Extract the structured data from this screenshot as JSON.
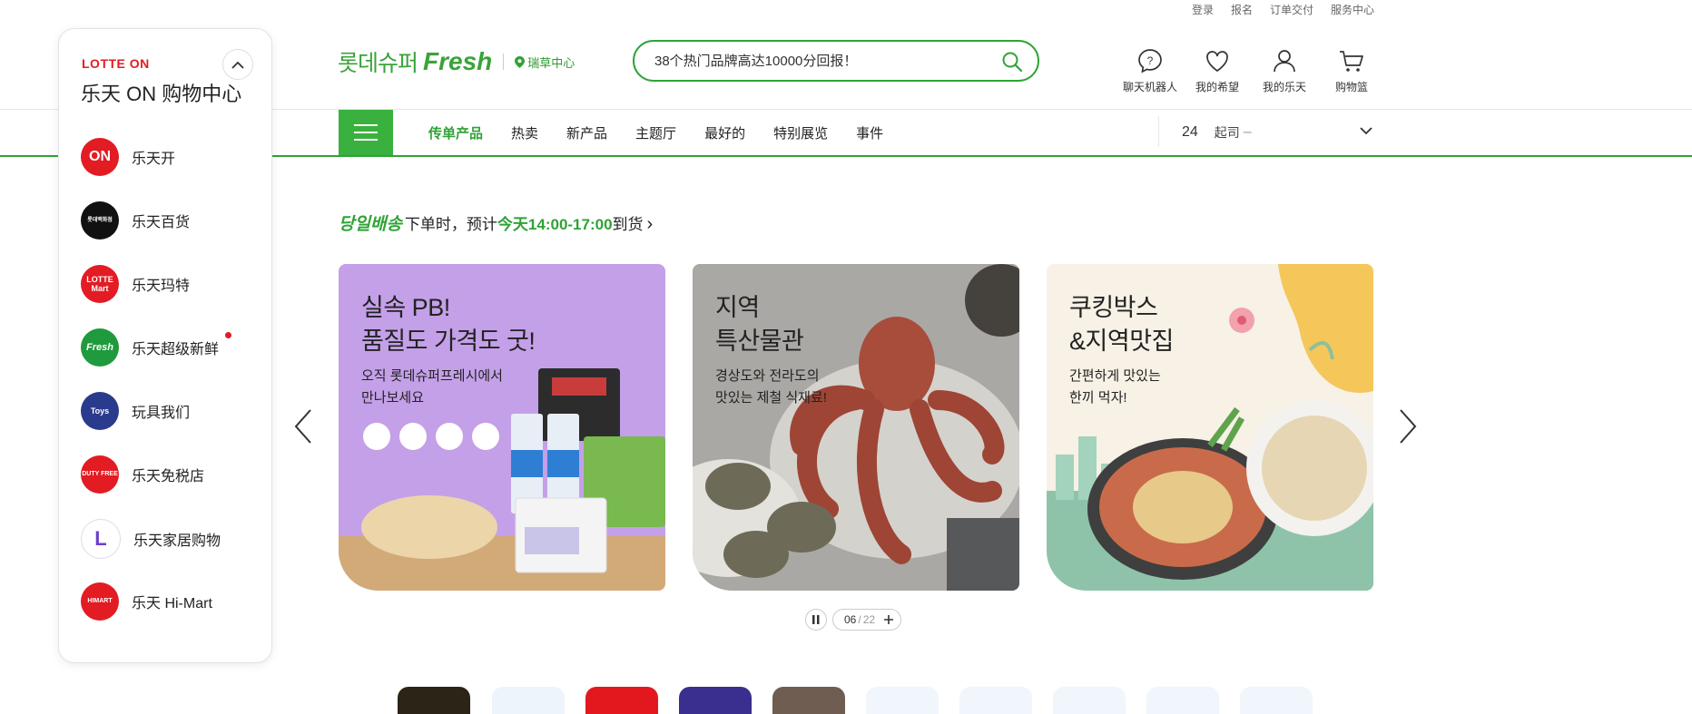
{
  "util_links": [
    "登录",
    "报名",
    "订单交付",
    "服务中心"
  ],
  "header": {
    "logo_korean": "롯데슈퍼",
    "logo_fresh": "Fresh",
    "store_name": "瑞草中心",
    "search_placeholder": "38个热门品牌高达10000分回报！",
    "icons": [
      {
        "icon": "chatbot-icon",
        "label": "聊天机器人"
      },
      {
        "icon": "heart-icon",
        "label": "我的希望"
      },
      {
        "icon": "user-icon",
        "label": "我的乐天"
      },
      {
        "icon": "cart-icon",
        "label": "购物篮"
      }
    ]
  },
  "nav": {
    "items": [
      "传单产品",
      "热卖",
      "新产品",
      "主题厅",
      "最好的",
      "特别展览",
      "事件"
    ],
    "active_index": 0,
    "delivery_num": "24",
    "delivery_label": "起司",
    "delivery_dash": "–"
  },
  "sameday": {
    "korean": "당일배송",
    "text1": "下单时，预计",
    "highlight": "今天14:00-17:00",
    "text2": "到货",
    "arrow": "›"
  },
  "banners": [
    {
      "title1": "실속 PB!",
      "title2": "품질도 가격도 굿!",
      "sub1": "오직 롯데슈퍼프레시에서",
      "sub2": "만나보세요"
    },
    {
      "title1": "지역",
      "title2": "특산물관",
      "sub1": "경상도와 전라도의",
      "sub2": "맛있는 제철 식재료!"
    },
    {
      "title1": "쿠킹박스",
      "title2": "&지역맛집",
      "sub1": "간편하게 맛있는",
      "sub2": "한끼 먹자!"
    }
  ],
  "pager": {
    "current": "06",
    "sep": "/",
    "total": "22"
  },
  "panel": {
    "logo": "LOTTE ON",
    "title": "乐天 ON 购物中心",
    "items": [
      {
        "label": "乐天开",
        "icon_text": "ON",
        "color": "#e31b23"
      },
      {
        "label": "乐天百货",
        "icon_text": "롯데백화점",
        "color": "#111111"
      },
      {
        "label": "乐天玛特",
        "icon_text": "LOTTE Mart",
        "color": "#e31b23"
      },
      {
        "label": "乐天超级新鲜",
        "icon_text": "Fresh",
        "color": "#1f9a3c"
      },
      {
        "label": "玩具我们",
        "icon_text": "Toys",
        "color": "#2a3a8c"
      },
      {
        "label": "乐天免税店",
        "icon_text": "DUTY FREE",
        "color": "#e31b23"
      },
      {
        "label": "乐天家居购物",
        "icon_text": "L",
        "color": "#ffffff"
      },
      {
        "label": "乐天 Hi-Mart",
        "icon_text": "HIMART",
        "color": "#e31b23"
      }
    ]
  },
  "colors": {
    "brand_green": "#2fa336",
    "lotte_red": "#e31b23"
  }
}
